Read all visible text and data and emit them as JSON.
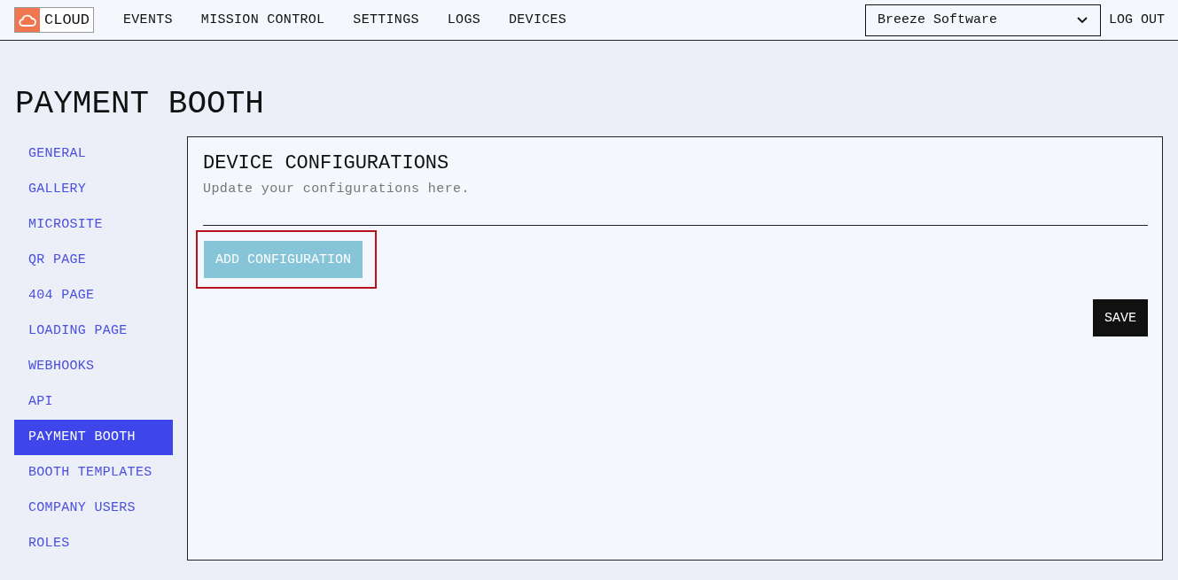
{
  "header": {
    "logo_text": "CLOUD",
    "nav": [
      {
        "label": "EVENTS"
      },
      {
        "label": "MISSION CONTROL"
      },
      {
        "label": "SETTINGS"
      },
      {
        "label": "LOGS"
      },
      {
        "label": "DEVICES"
      }
    ],
    "company_select": {
      "value": "Breeze Software"
    },
    "logout": "LOG OUT"
  },
  "page_title": "PAYMENT BOOTH",
  "sidebar": {
    "items": [
      {
        "label": "GENERAL",
        "selected": false
      },
      {
        "label": "GALLERY",
        "selected": false
      },
      {
        "label": "MICROSITE",
        "selected": false
      },
      {
        "label": "QR PAGE",
        "selected": false
      },
      {
        "label": "404 PAGE",
        "selected": false
      },
      {
        "label": "LOADING PAGE",
        "selected": false
      },
      {
        "label": "WEBHOOKS",
        "selected": false
      },
      {
        "label": "API",
        "selected": false
      },
      {
        "label": "PAYMENT BOOTH",
        "selected": true
      },
      {
        "label": "BOOTH TEMPLATES",
        "selected": false
      },
      {
        "label": "COMPANY USERS",
        "selected": false
      },
      {
        "label": "ROLES",
        "selected": false
      }
    ]
  },
  "panel": {
    "title": "DEVICE CONFIGURATIONS",
    "subtitle": "Update your configurations here.",
    "add_button": {
      "label": "ADD CONFIGURATION",
      "highlighted": true
    },
    "save_button": "SAVE"
  }
}
